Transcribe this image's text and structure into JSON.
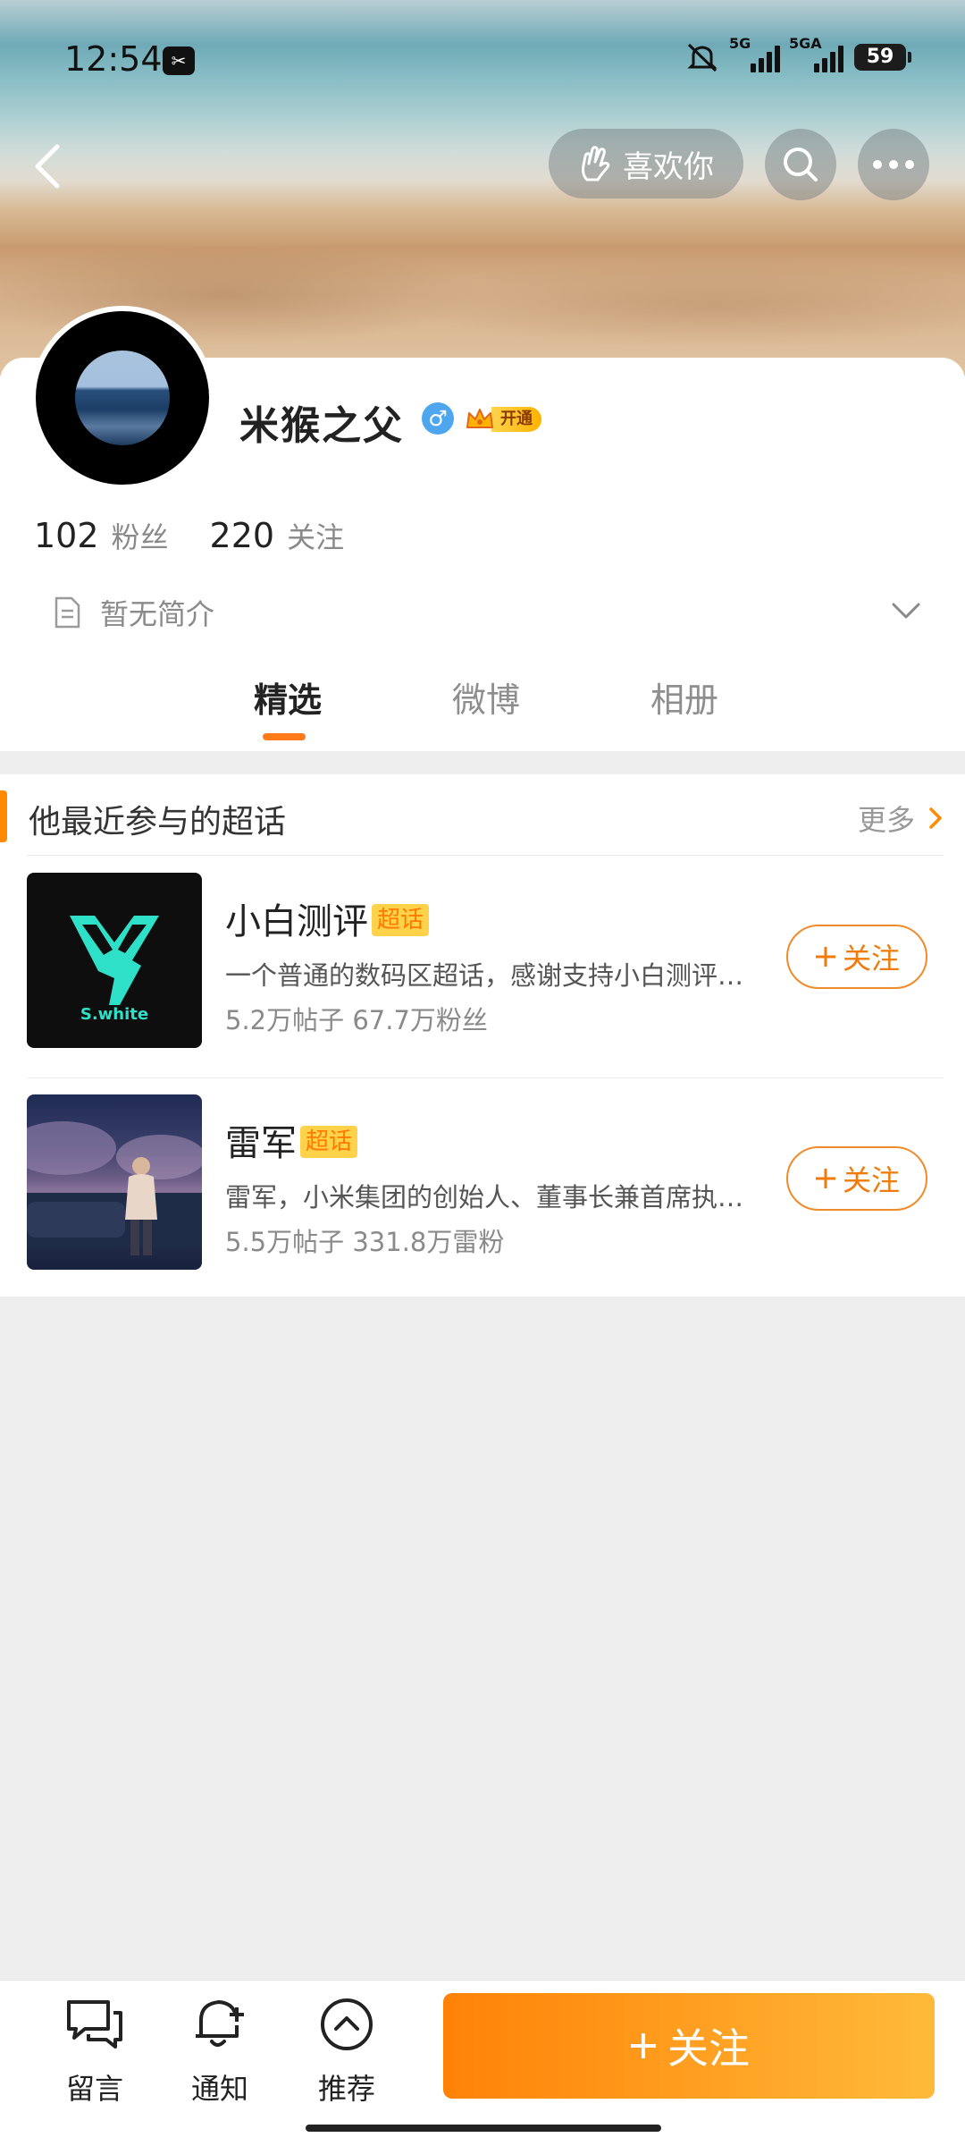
{
  "status": {
    "time": "12:54",
    "battery": "59",
    "sim1_label": "5G",
    "sim2_label": "5GA"
  },
  "header": {
    "like_button": "喜欢你"
  },
  "profile": {
    "name": "米猴之父",
    "vip_label": "开通",
    "fans_count": "102",
    "fans_label": "粉丝",
    "following_count": "220",
    "following_label": "关注",
    "bio": "暂无简介"
  },
  "tabs": [
    {
      "label": "精选",
      "active": true
    },
    {
      "label": "微博",
      "active": false
    },
    {
      "label": "相册",
      "active": false
    }
  ],
  "super_topics": {
    "title": "他最近参与的超话",
    "more": "更多",
    "items": [
      {
        "name": "小白测评",
        "tag": "超话",
        "desc": "一个普通的数码区超话，感谢支持小白测评超话",
        "meta": "5.2万帖子 67.7万粉丝",
        "follow": "关注",
        "thumb_text": "S.white"
      },
      {
        "name": "雷军",
        "tag": "超话",
        "desc": "雷军，小米集团的创始人、董事长兼首席执行官",
        "meta": "5.5万帖子 331.8万雷粉",
        "follow": "关注"
      }
    ]
  },
  "bottom_bar": {
    "message": "留言",
    "notify": "通知",
    "recommend": "推荐",
    "follow": "关注"
  },
  "colors": {
    "accent": "#ff8206",
    "accent_light": "#ffba3a",
    "tag_bg": "#ffd24a"
  }
}
